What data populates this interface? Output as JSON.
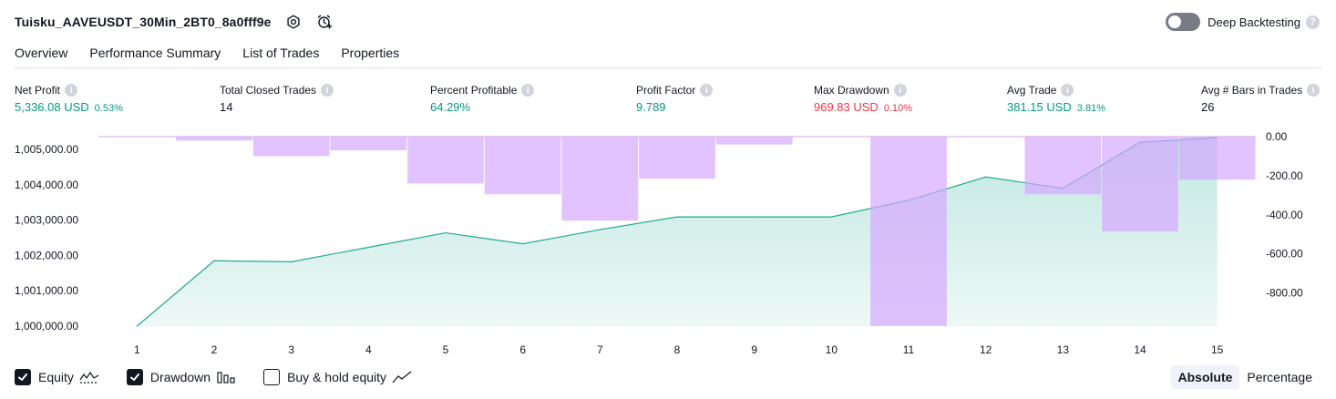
{
  "header": {
    "title": "Tuisku_AAVEUSDT_30Min_2BT0_8a0fff9e",
    "deep_backtesting_label": "Deep Backtesting",
    "deep_backtesting_enabled": false
  },
  "tabs": [
    {
      "label": "Overview",
      "active": true
    },
    {
      "label": "Performance Summary",
      "active": false
    },
    {
      "label": "List of Trades",
      "active": false
    },
    {
      "label": "Properties",
      "active": false
    }
  ],
  "metrics": [
    {
      "label": "Net Profit",
      "value": "5,336.08 USD",
      "pct": "0.53%",
      "tone": "green"
    },
    {
      "label": "Total Closed Trades",
      "value": "14",
      "pct": "",
      "tone": "dark"
    },
    {
      "label": "Percent Profitable",
      "value": "64.29%",
      "pct": "",
      "tone": "green"
    },
    {
      "label": "Profit Factor",
      "value": "9.789",
      "pct": "",
      "tone": "green"
    },
    {
      "label": "Max Drawdown",
      "value": "969.83 USD",
      "pct": "0.10%",
      "tone": "red"
    },
    {
      "label": "Avg Trade",
      "value": "381.15 USD",
      "pct": "3.81%",
      "tone": "green"
    },
    {
      "label": "Avg # Bars in Trades",
      "value": "26",
      "pct": "",
      "tone": "dark"
    }
  ],
  "chart_data": {
    "type": "line",
    "x": [
      1,
      2,
      3,
      4,
      5,
      6,
      7,
      8,
      9,
      10,
      11,
      12,
      13,
      14,
      15
    ],
    "x_tick_labels": [
      "1",
      "2",
      "3",
      "4",
      "5",
      "6",
      "7",
      "8",
      "9",
      "10",
      "11",
      "12",
      "13",
      "14",
      "15"
    ],
    "left_axis": {
      "ticks": [
        1000000,
        1001000,
        1002000,
        1003000,
        1004000,
        1005000
      ],
      "tick_labels": [
        "1,000,000.00",
        "1,001,000.00",
        "1,002,000.00",
        "1,003,000.00",
        "1,004,000.00",
        "1,005,000.00"
      ],
      "ylim": [
        1000000,
        1005336
      ]
    },
    "right_axis": {
      "ticks": [
        0,
        -200,
        -400,
        -600,
        -800
      ],
      "tick_labels": [
        "0.00",
        "-200.00",
        "-400.00",
        "-600.00",
        "-800.00"
      ],
      "ylim": [
        -969.83,
        0
      ]
    },
    "series": [
      {
        "name": "Equity",
        "type": "area",
        "axis": "left",
        "color": "#089981",
        "values": [
          1000000,
          1001850,
          1001820,
          1002230,
          1002640,
          1002330,
          1002730,
          1003090,
          1003090,
          1003090,
          1003560,
          1004220,
          1003900,
          1005200,
          1005336
        ]
      },
      {
        "name": "Drawdown",
        "type": "bar",
        "axis": "right",
        "color": "#d6a8ff",
        "values": [
          0,
          -20,
          -100,
          -70,
          -240,
          -295,
          -430,
          -215,
          -40,
          0,
          -969.83,
          0,
          -295,
          -485,
          -220
        ]
      }
    ],
    "legend_placement": "bottom-left",
    "grid": false
  },
  "legend": {
    "items": [
      {
        "label": "Equity",
        "checked": true,
        "icon": "equity-wave-icon"
      },
      {
        "label": "Drawdown",
        "checked": true,
        "icon": "drawdown-bars-icon"
      },
      {
        "label": "Buy & hold equity",
        "checked": false,
        "icon": "buy-hold-line-icon"
      }
    ]
  },
  "mode": {
    "options": [
      "Absolute",
      "Percentage"
    ],
    "selected": "Absolute"
  },
  "colors": {
    "green": "#089981",
    "red": "#f23645",
    "drawdown_fill": "#d6a8ff",
    "equity_line": "#22ab94",
    "text": "#131722"
  }
}
